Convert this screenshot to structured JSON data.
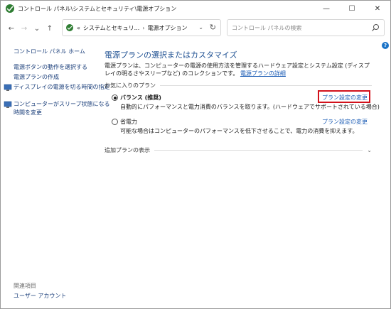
{
  "window": {
    "title": "コントロール パネル\\システムとセキュリティ\\電源オプション",
    "minimize": "—",
    "maximize": "☐",
    "close": "✕"
  },
  "address": {
    "overflow": "«",
    "crumbs": [
      "システムとセキュリ...",
      "電源オプション"
    ],
    "separator": "›",
    "dropdown": "⌄",
    "refresh": "↻",
    "search_placeholder": "コントロール パネルの検索"
  },
  "nav": {
    "back": "←",
    "forward": "→",
    "recent": "⌄",
    "up": "↑"
  },
  "sidebar": {
    "home": "コントロール パネル ホーム",
    "items": [
      "電源ボタンの動作を選択する",
      "電源プランの作成",
      "ディスプレイの電源を切る時間の指定",
      "コンピューターがスリープ状態になる",
      "時間を変更"
    ],
    "related_label": "関連項目",
    "related_items": [
      "ユーザー アカウント"
    ]
  },
  "main": {
    "title": "電源プランの選択またはカスタマイズ",
    "description": "電源プランは、コンピューターの電源の使用方法を管理するハードウェア設定とシステム設定 (ディスプレイの明るさやスリープなど) のコレクションです。",
    "description_link": "電源プランの詳細",
    "favorites_label": "お気に入りのプラン",
    "plans": [
      {
        "name": "バランス (推奨)",
        "description": "自動的にパフォーマンスと電力消費のバランスを取ります。(ハードウェアでサポートされている場合)",
        "link": "プラン設定の変更",
        "selected": true
      },
      {
        "name": "省電力",
        "description": "可能な場合はコンピューターのパフォーマンスを低下させることで、電力の消費を抑えます。",
        "link": "プラン設定の変更",
        "selected": false
      }
    ],
    "additional_label": "追加プランの表示",
    "additional_chevron": "⌄"
  },
  "help": "?",
  "colors": {
    "accent": "#1d4f91",
    "link": "#1a5bb5",
    "highlight": "#d2111b"
  }
}
